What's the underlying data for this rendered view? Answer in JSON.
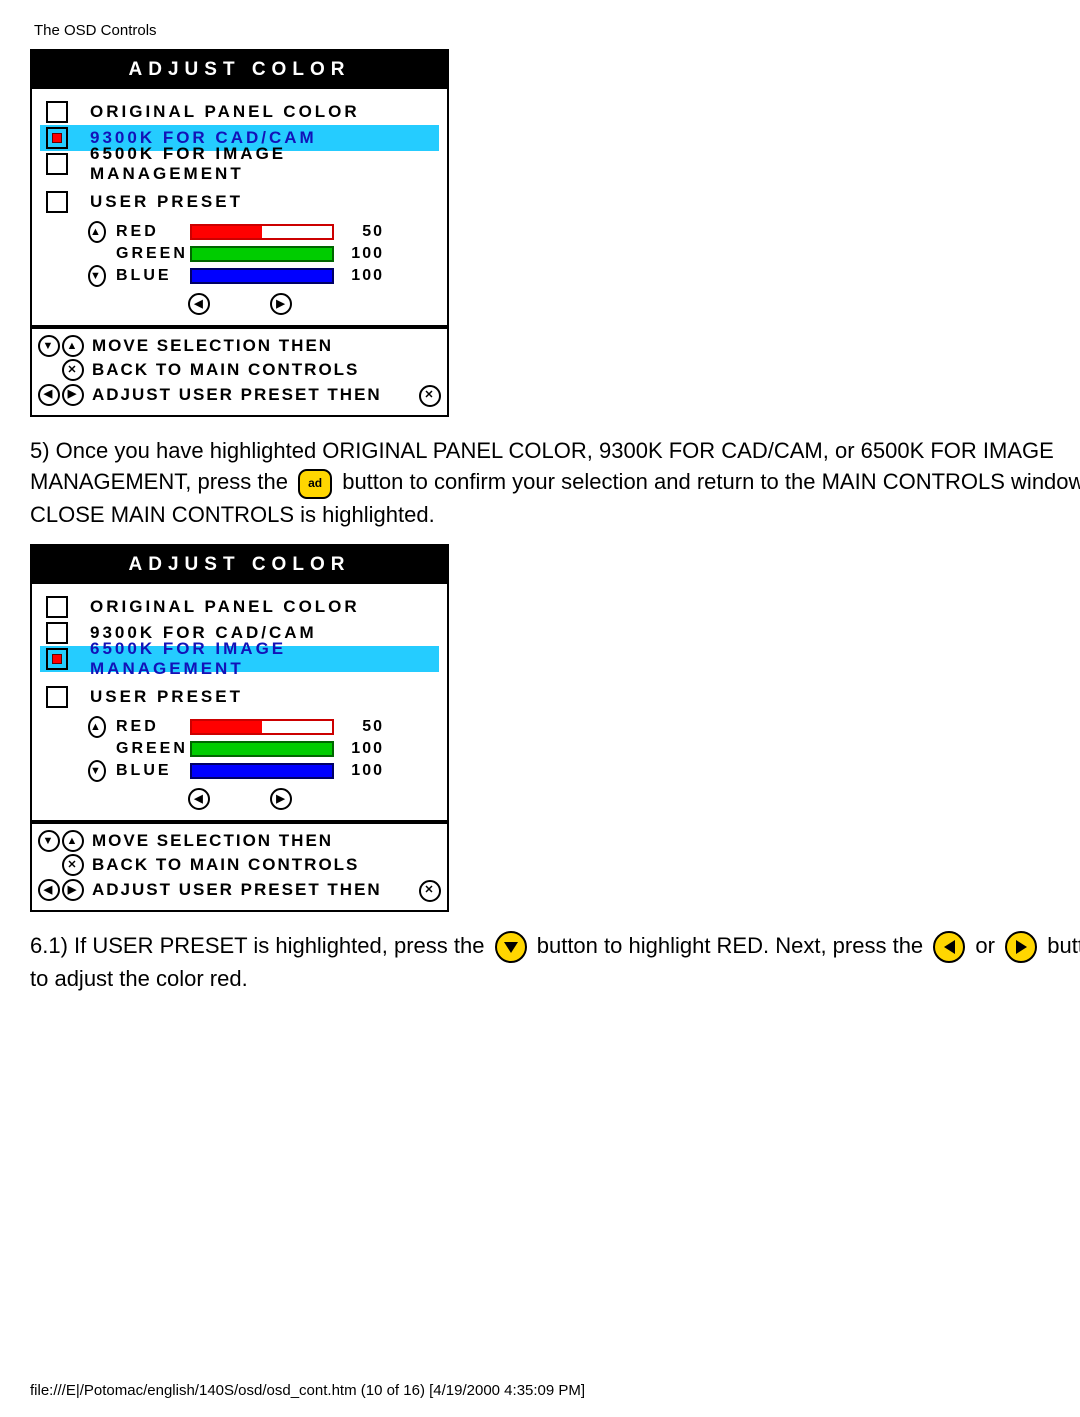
{
  "header": "The OSD Controls",
  "icons": {
    "ok": "ad"
  },
  "osd1": {
    "title": "ADJUST COLOR",
    "options": [
      {
        "label": "ORIGINAL PANEL COLOR"
      },
      {
        "label": "9300K FOR CAD/CAM"
      },
      {
        "label": "6500K FOR IMAGE MANAGEMENT"
      },
      {
        "label": "USER PRESET"
      }
    ],
    "preset": [
      {
        "name": "RED",
        "value": "50"
      },
      {
        "name": "GREEN",
        "value": "100"
      },
      {
        "name": "BLUE",
        "value": "100"
      }
    ],
    "hints": [
      "MOVE SELECTION THEN",
      "BACK TO MAIN CONTROLS",
      "ADJUST USER PRESET THEN"
    ]
  },
  "osd2": {
    "title": "ADJUST COLOR",
    "options": [
      {
        "label": "ORIGINAL PANEL COLOR"
      },
      {
        "label": "9300K FOR CAD/CAM"
      },
      {
        "label": "6500K FOR IMAGE MANAGEMENT"
      },
      {
        "label": "USER PRESET"
      }
    ],
    "preset": [
      {
        "name": "RED",
        "value": "50"
      },
      {
        "name": "GREEN",
        "value": "100"
      },
      {
        "name": "BLUE",
        "value": "100"
      }
    ],
    "hints": [
      "MOVE SELECTION THEN",
      "BACK TO MAIN CONTROLS",
      "ADJUST USER PRESET THEN"
    ]
  },
  "para5": {
    "a": "5) Once you have highlighted ORIGINAL PANEL COLOR, 9300K FOR CAD/CAM, or 6500K FOR IMAGE MANAGEMENT, press the",
    "b": "button to confirm your selection and return to the MAIN CONTROLS window. CLOSE MAIN CONTROLS is highlighted."
  },
  "para6": {
    "a": "6.1) If USER PRESET is highlighted, press the",
    "b": "button to highlight RED. Next, press the",
    "c": "or",
    "d": "button to adjust the color red."
  },
  "footer": "file:///E|/Potomac/english/140S/osd/osd_cont.htm (10 of 16) [4/19/2000 4:35:09 PM]"
}
